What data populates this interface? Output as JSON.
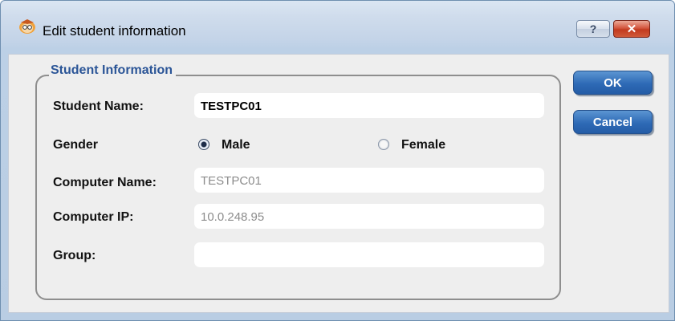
{
  "window": {
    "title": "Edit student information"
  },
  "titlebar_buttons": {
    "help_label": "?",
    "close_label": "✕"
  },
  "group": {
    "legend": "Student Information"
  },
  "form": {
    "student_name_label": "Student Name:",
    "student_name_value": "TESTPC01",
    "gender_label": "Gender",
    "gender_options": [
      "Male",
      "Female"
    ],
    "gender_selected": "Male",
    "computer_name_label": "Computer Name:",
    "computer_name_value": "TESTPC01",
    "computer_ip_label": "Computer IP:",
    "computer_ip_value": "10.0.248.95",
    "group_label": "Group:",
    "group_value": ""
  },
  "buttons": {
    "ok_label": "OK",
    "cancel_label": "Cancel"
  },
  "colors": {
    "legend": "#2b5597",
    "button": "#2e6ab6",
    "close_button": "#c23a1f"
  },
  "icons": {
    "app": "student-avatar-icon",
    "help": "help-icon",
    "close": "close-icon"
  }
}
